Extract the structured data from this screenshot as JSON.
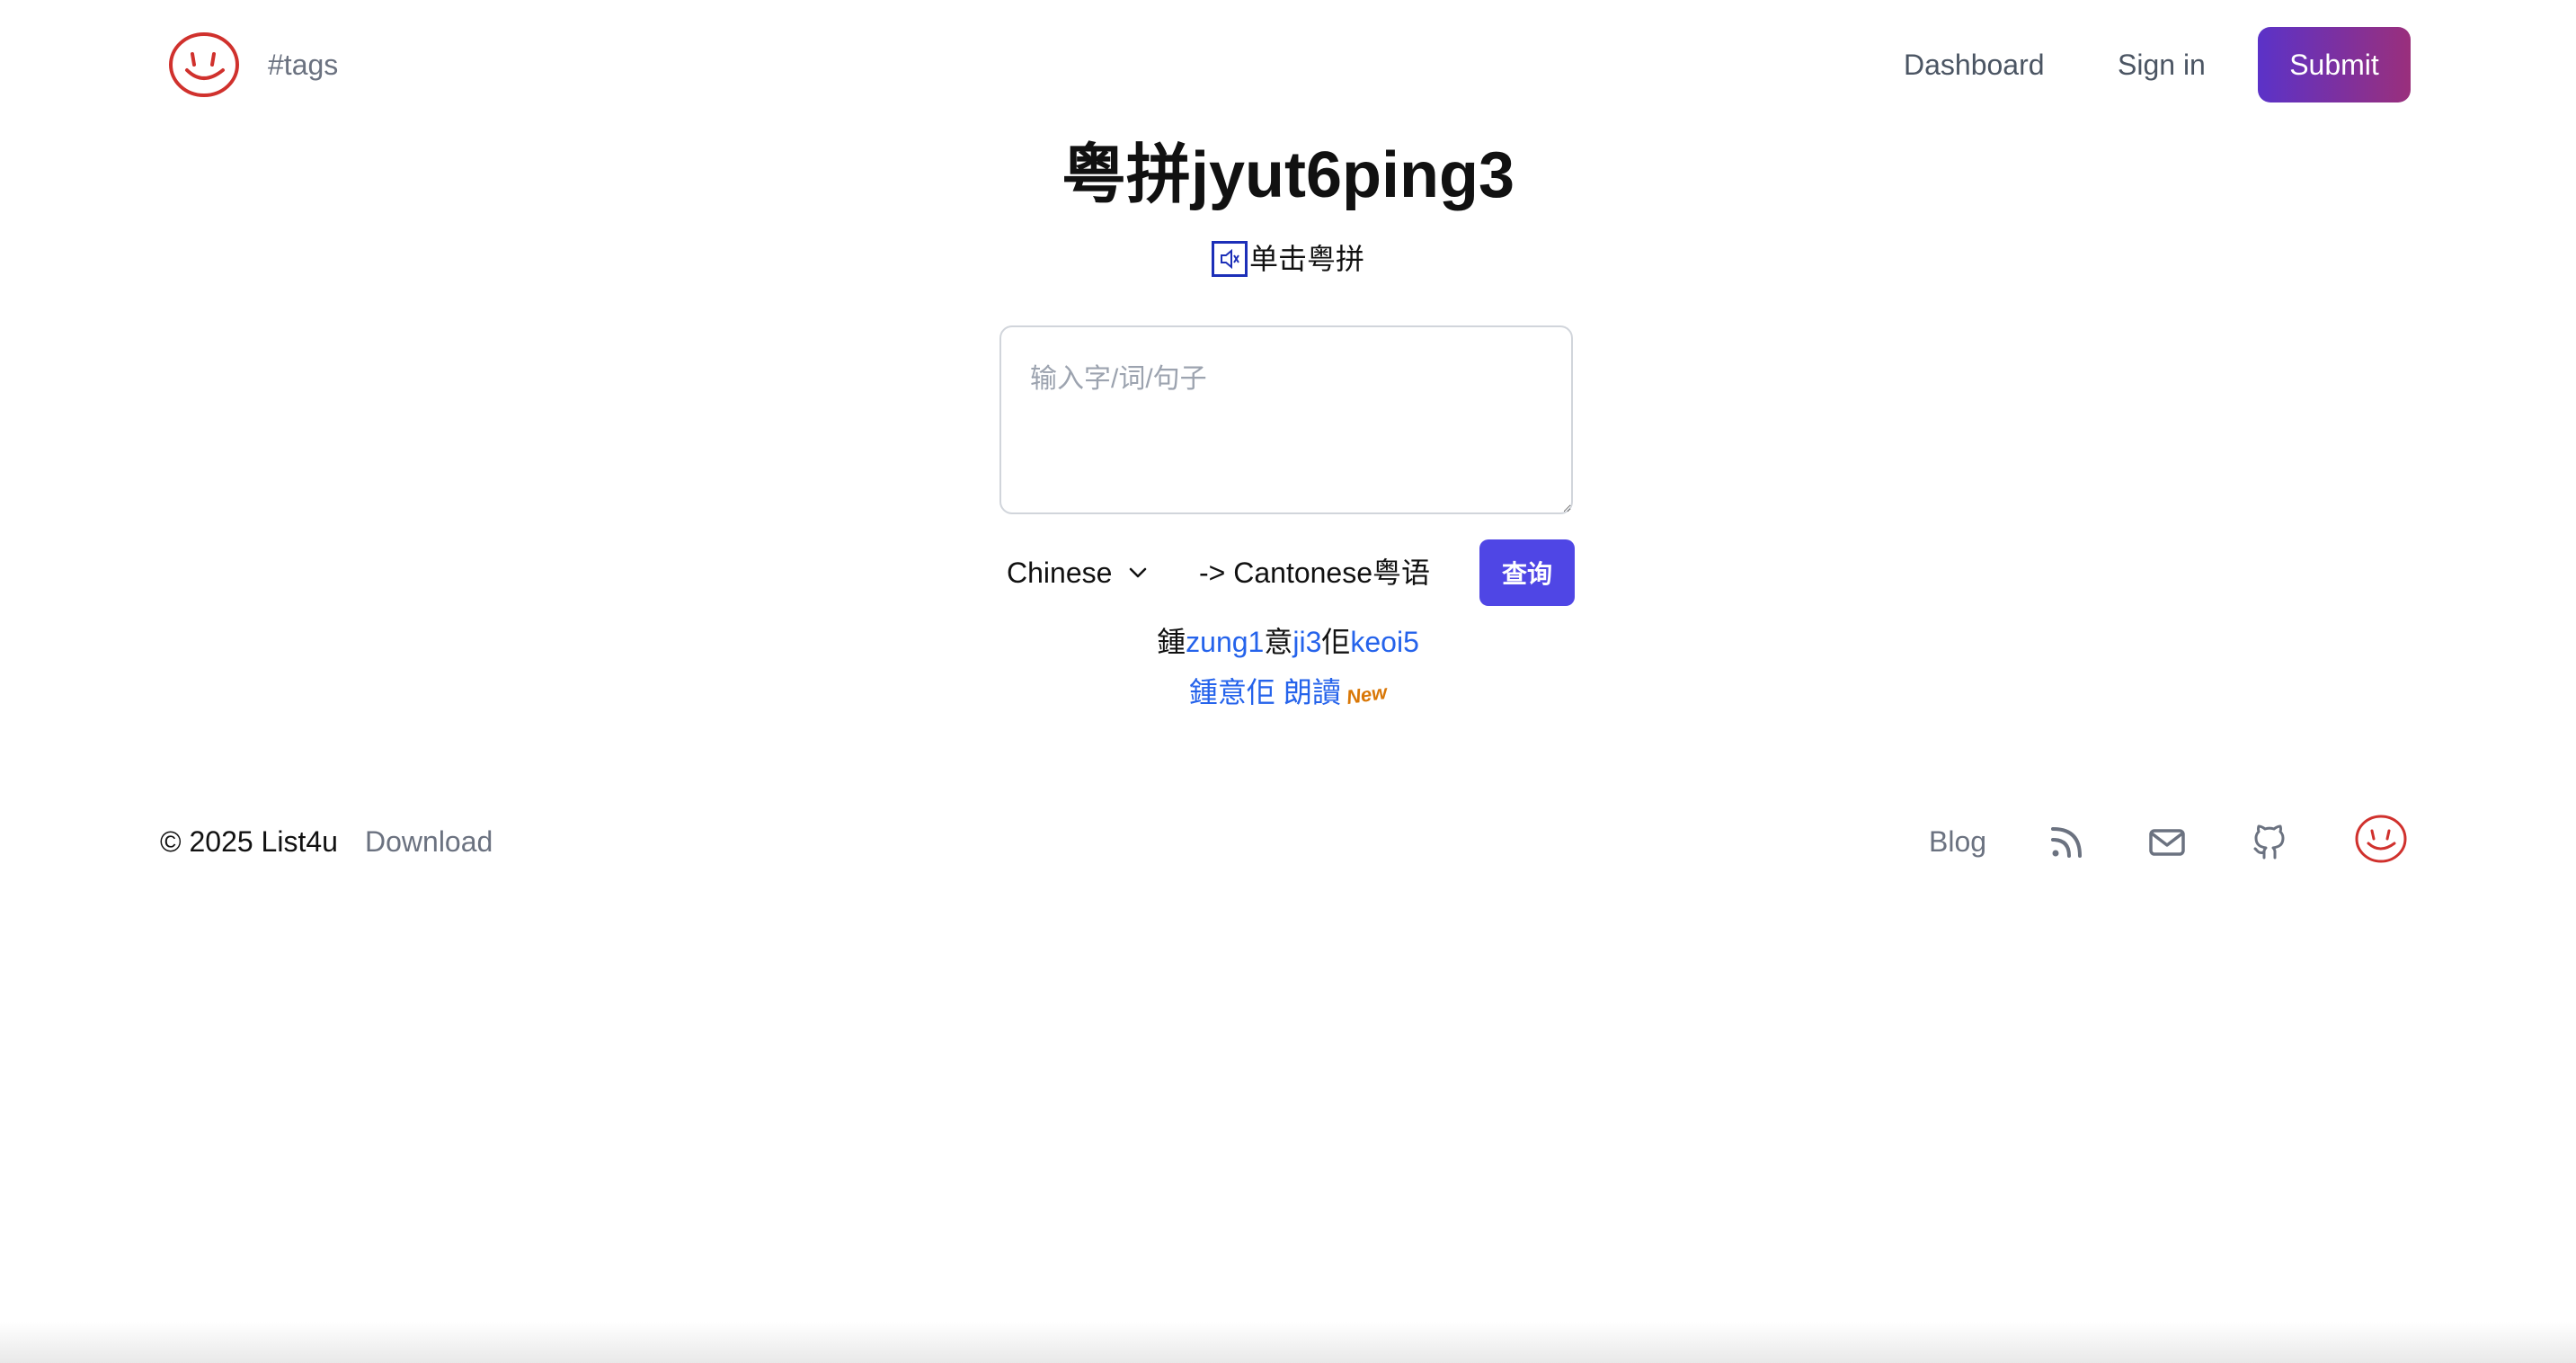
{
  "header": {
    "tags_label": "#tags",
    "nav": {
      "dashboard": "Dashboard",
      "sign_in": "Sign in",
      "submit": "Submit"
    }
  },
  "main": {
    "title": "粤拼jyut6ping3",
    "speak_hint": "单击粤拼",
    "input": {
      "value": "",
      "placeholder": "输入字/词/句子"
    },
    "source_lang": "Chinese",
    "target_lang": "-> Cantonese粤语",
    "query_button": "查询",
    "result": [
      {
        "char": "鍾",
        "jyutping": "zung1"
      },
      {
        "char": "意",
        "jyutping": "ji3"
      },
      {
        "char": "佢",
        "jyutping": "keoi5"
      }
    ],
    "read_aloud_link": "鍾意佢 朗讀",
    "new_badge": "New"
  },
  "footer": {
    "copyright": "© 2025 List4u",
    "download": "Download",
    "blog": "Blog"
  },
  "colors": {
    "accent": "#4f46e5",
    "link": "#2563eb",
    "logo_red": "#d0312d",
    "submit_gradient_start": "#5b32c8",
    "submit_gradient_end": "#9a2f7c"
  },
  "icons": {
    "logo": "smiley-face-icon",
    "speaker": "speaker-icon",
    "dropdown": "chevron-down-icon",
    "rss": "rss-icon",
    "mail": "mail-icon",
    "github": "github-icon"
  }
}
